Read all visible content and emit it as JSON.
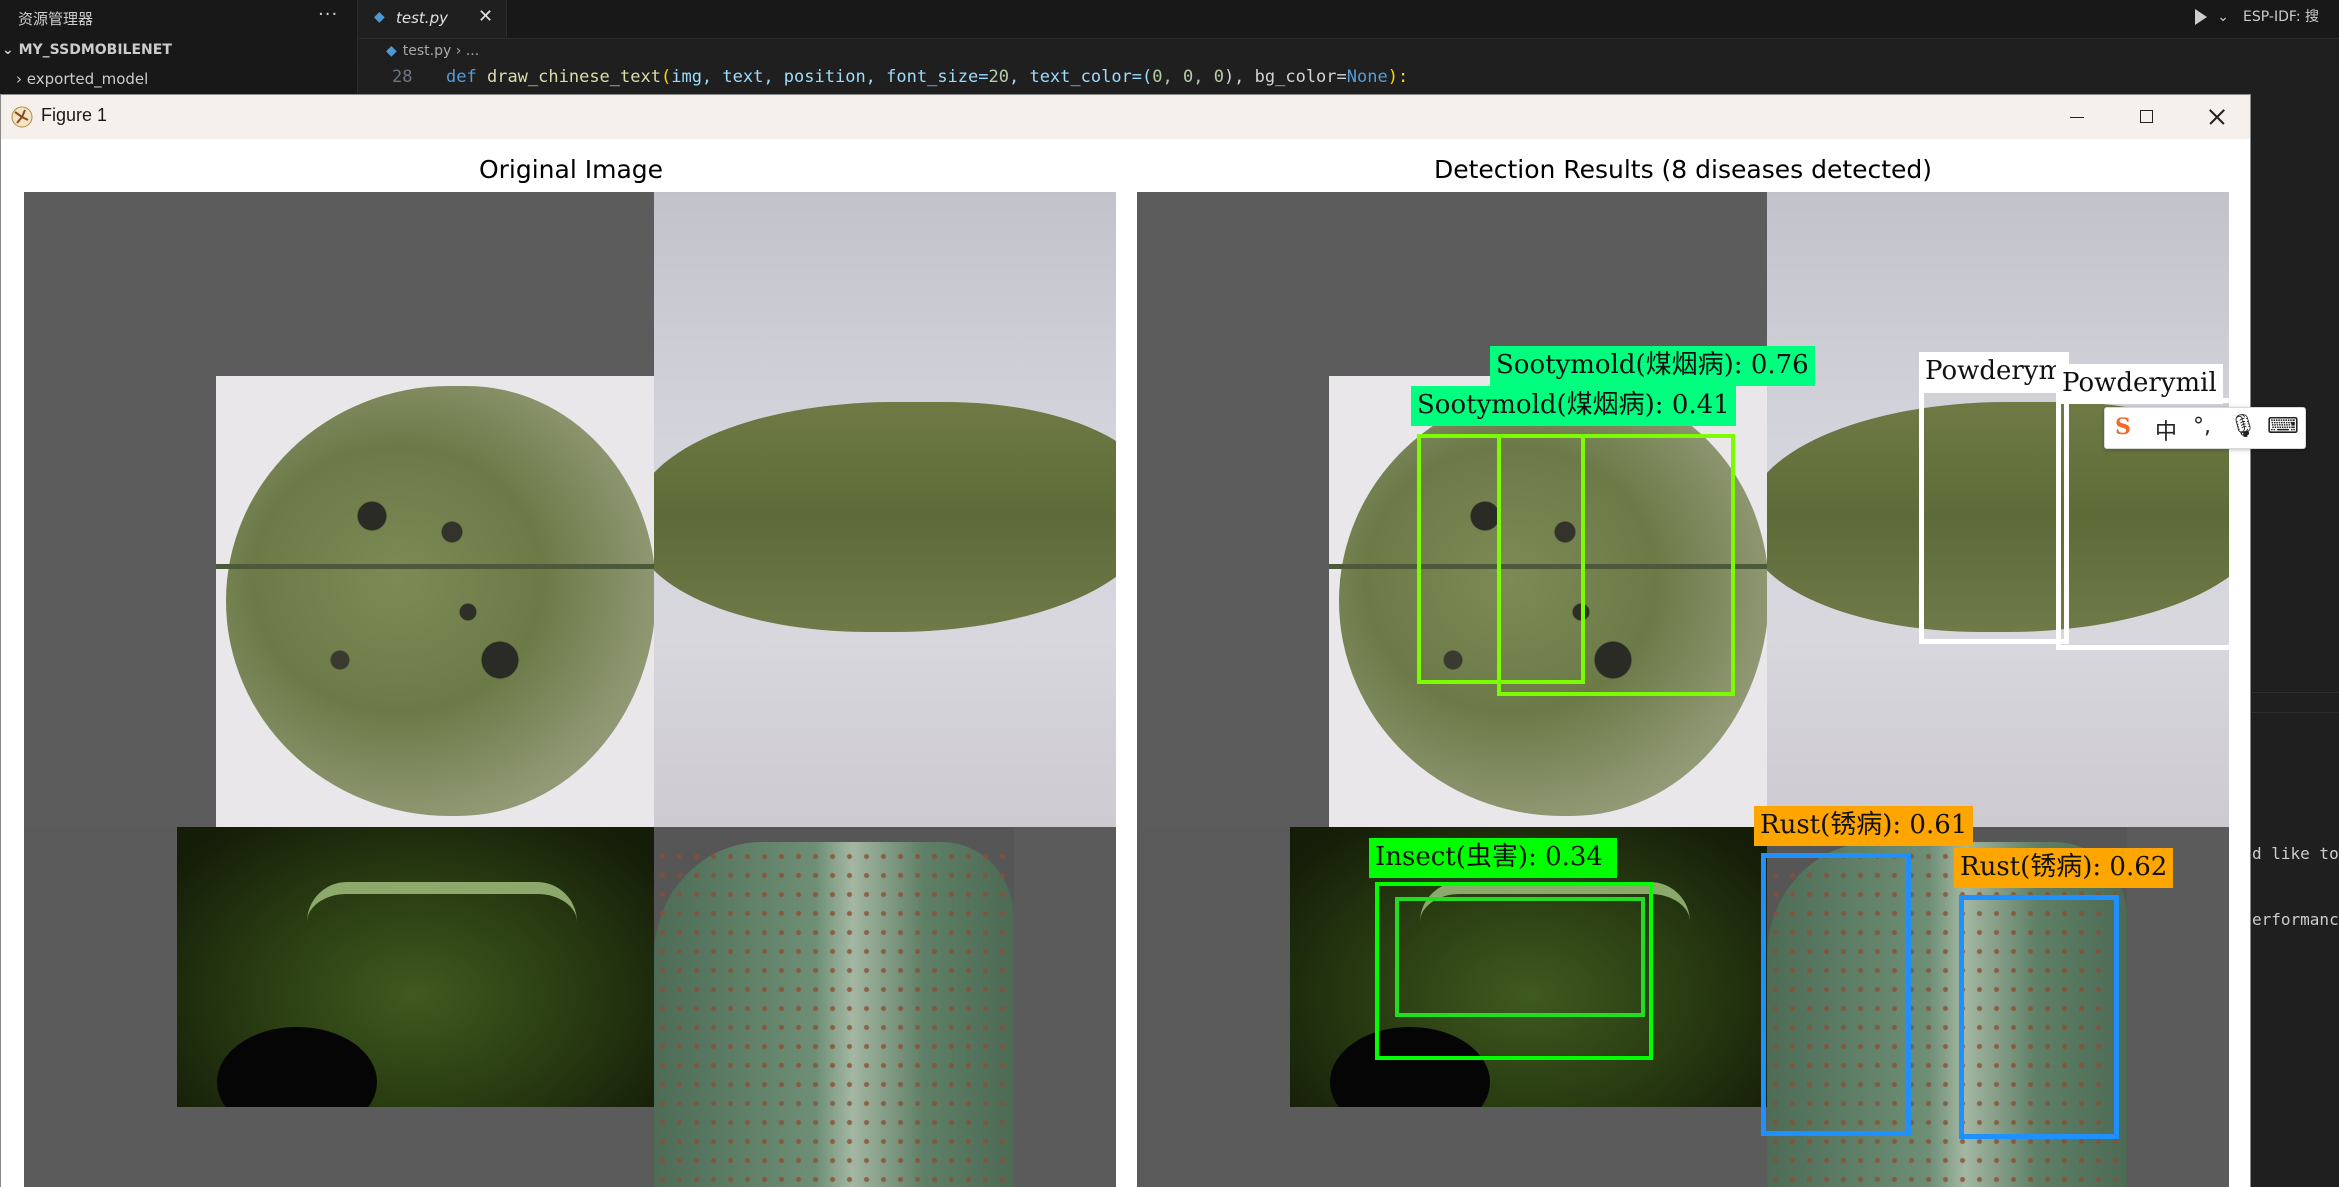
{
  "vscode": {
    "explorer_title": "资源管理器",
    "explorer_more": "···",
    "project": "MY_SSDMOBILENET",
    "folder": "exported_model",
    "tab": "test.py",
    "run_label": "ESP-IDF: 搜",
    "breadcrumb_file": "test.py",
    "breadcrumb_more": "...",
    "line_number": "28",
    "code": {
      "kw": "def",
      "fn": "draw_chinese_text",
      "args": "img, text, position, font_size=",
      "fs": "20",
      "tc": ", text_color=(",
      "zeros": "0, 0, 0",
      "bg": "), bg_color=",
      "none": "None",
      "end": "):"
    },
    "terminal_lines": [
      "d like to",
      "erformance"
    ]
  },
  "figure": {
    "window_title": "Figure 1",
    "left_title": "Original Image",
    "right_title": "Detection Results (8 diseases detected)"
  },
  "detections": [
    {
      "label": "Sootymold(煤烟病): 0.76",
      "color": "#7cfc00",
      "label_bg": "#00ff7f"
    },
    {
      "label": "Sootymold(煤烟病): 0.41",
      "color": "#7cfc00",
      "label_bg": "#00ff7f"
    },
    {
      "label": "Powderym",
      "color": "#ffffff",
      "label_bg": "#ffffff"
    },
    {
      "label": "Powderymil",
      "color": "#ffffff",
      "label_bg": "#ffffff"
    },
    {
      "label": "Insect(虫害): 0.34",
      "color": "#00ff00",
      "label_bg": "#00ff00"
    },
    {
      "label": "Rust(锈病): 0.61",
      "color": "#1e90ff",
      "label_bg": "#ffa500"
    },
    {
      "label": "Rust(锈病): 0.62",
      "color": "#1e90ff",
      "label_bg": "#ffa500"
    }
  ],
  "ime": {
    "lang": "中",
    "brand_icon": "sogou-icon"
  }
}
